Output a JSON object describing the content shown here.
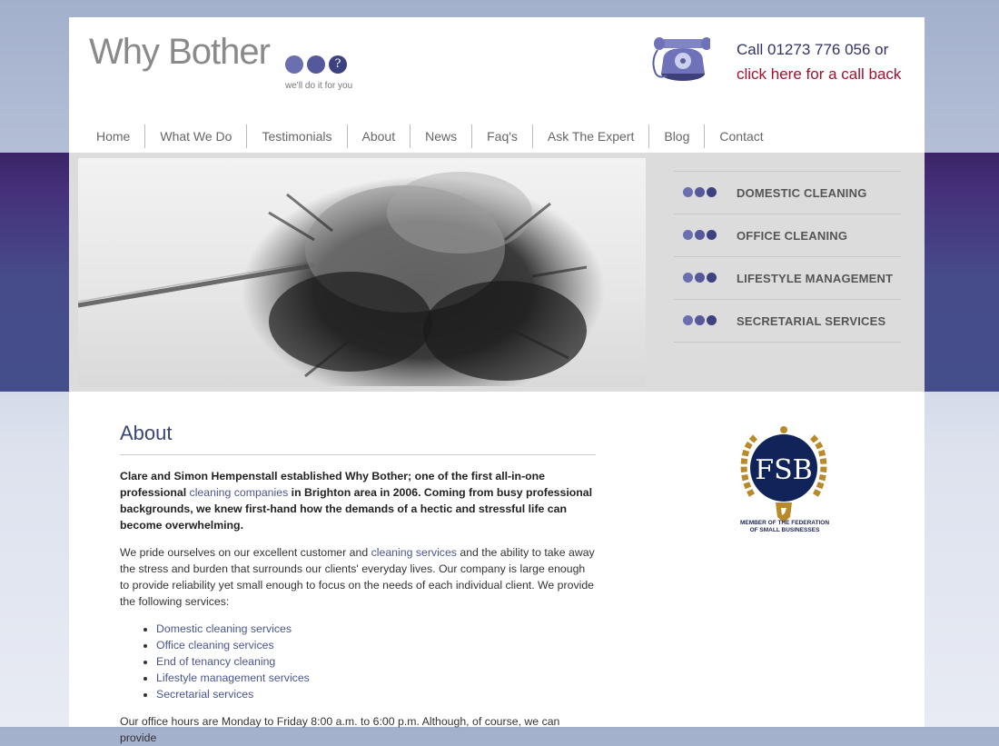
{
  "header": {
    "logo_text": "Why Bother",
    "logo_tagline": "we'll do it for you",
    "logo_question": "?",
    "call_line": "Call 01273 776 056 or",
    "callback_link": "click here for a call back"
  },
  "nav": {
    "items": [
      "Home",
      "What We Do",
      "Testimonials",
      "About",
      "News",
      "Faq's",
      "Ask The Expert",
      "Blog",
      "Contact"
    ]
  },
  "services_menu": {
    "items": [
      "DOMESTIC CLEANING",
      "OFFICE CLEANING",
      "LIFESTYLE MANAGEMENT",
      "SECRETARIAL SERVICES"
    ]
  },
  "content": {
    "heading": "About",
    "intro_part1": "Clare and Simon Hempenstall established Why Bother; one of the first all-in-one professional ",
    "intro_link": "cleaning companies",
    "intro_part2": " in Brighton area in 2006. Coming from busy professional backgrounds, we knew first-hand how the demands of a hectic and stressful life can become overwhelming.",
    "para2_part1": "We pride ourselves on our excellent customer and ",
    "para2_link": "cleaning services",
    "para2_part2": " and the ability to take away the stress and burden that surrounds our clients' everyday lives. Our company is large enough to provide reliability yet small enough to focus on the needs of each individual client. We provide the following services:",
    "services_list": [
      "Domestic cleaning services",
      "Office cleaning services",
      "End of tenancy cleaning",
      "Lifestyle management services",
      "Secretarial services"
    ],
    "para3": "Our office hours are Monday to Friday 8:00 a.m. to 6:00 p.m. Although, of course, we can provide"
  },
  "badge": {
    "acronym": "FSB",
    "caption_line1": "MEMBER OF THE FEDERATION",
    "caption_line2": "OF SMALL BUSINESSES"
  },
  "colors": {
    "brand_purple": "#5b5f9e",
    "brand_dark": "#3b4677",
    "callback_red": "#a3112f",
    "badge_navy": "#10245a",
    "badge_gold": "#b98a2a"
  }
}
